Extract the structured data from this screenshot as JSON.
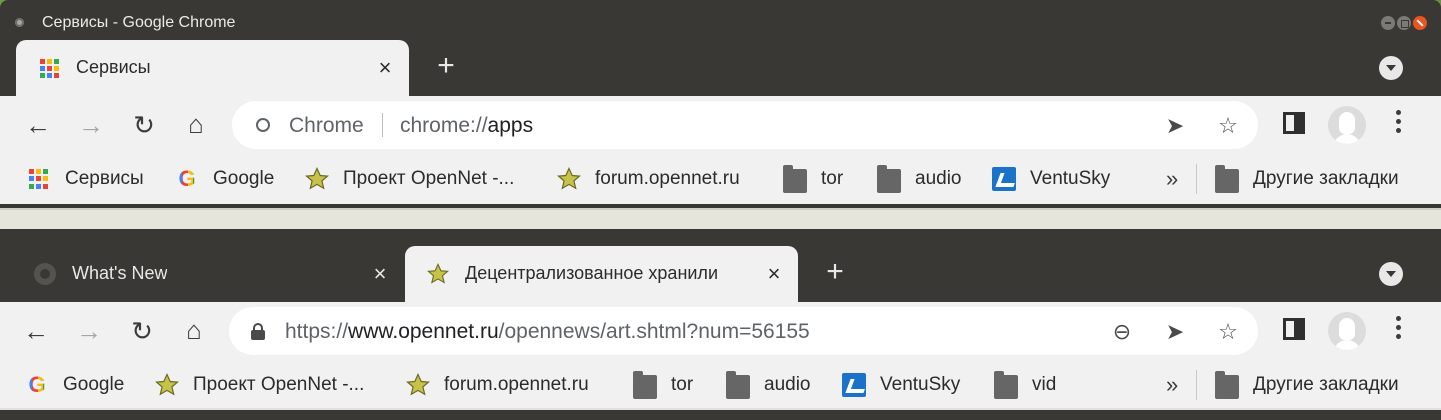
{
  "window1": {
    "title": "Сервисы - Google Chrome",
    "tabs": [
      {
        "label": "Сервисы",
        "close": "×",
        "active": true
      }
    ],
    "new_tab": "+",
    "toolbar": {
      "back": "←",
      "forward": "→",
      "reload": "↻",
      "home": "⌂",
      "omnibox_chip": "Chrome",
      "url_scheme": "chrome://",
      "url_domain": "apps",
      "url_path": "",
      "share": "➤",
      "star": "☆"
    },
    "bookmarks": [
      {
        "label": "Сервисы",
        "icon": "apps-grid-icon"
      },
      {
        "label": "Google",
        "icon": "google-icon"
      },
      {
        "label": "Проект OpenNet -...",
        "icon": "star-icon"
      },
      {
        "label": "forum.opennet.ru",
        "icon": "star-icon"
      },
      {
        "label": "tor",
        "icon": "folder-icon"
      },
      {
        "label": "audio",
        "icon": "folder-icon"
      },
      {
        "label": "VentuSky",
        "icon": "ventusky-icon"
      }
    ],
    "more_bookmarks": "»",
    "other_bookmarks": "Другие закладки"
  },
  "window2": {
    "tabs": [
      {
        "label": "What's New",
        "close": "×",
        "active": false
      },
      {
        "label": "Децентрализованное хранили",
        "close": "×",
        "active": true
      }
    ],
    "new_tab": "+",
    "toolbar": {
      "back": "←",
      "forward": "→",
      "reload": "↻",
      "home": "⌂",
      "url_scheme": "https://",
      "url_domain": "www.opennet.ru",
      "url_path": "/opennews/art.shtml?num=56155",
      "zoom": "⊖",
      "share": "➤",
      "star": "☆"
    },
    "bookmarks": [
      {
        "label": "Google",
        "icon": "google-icon"
      },
      {
        "label": "Проект OpenNet -...",
        "icon": "star-icon"
      },
      {
        "label": "forum.opennet.ru",
        "icon": "star-icon"
      },
      {
        "label": "tor",
        "icon": "folder-icon"
      },
      {
        "label": "audio",
        "icon": "folder-icon"
      },
      {
        "label": "VentuSky",
        "icon": "ventusky-icon"
      },
      {
        "label": "vid",
        "icon": "folder-icon"
      }
    ],
    "more_bookmarks": "»",
    "other_bookmarks": "Другие закладки"
  },
  "colors": {
    "titlebar": "#3a3834",
    "toolbar": "#f1f1f1",
    "close_button": "#e95420"
  }
}
